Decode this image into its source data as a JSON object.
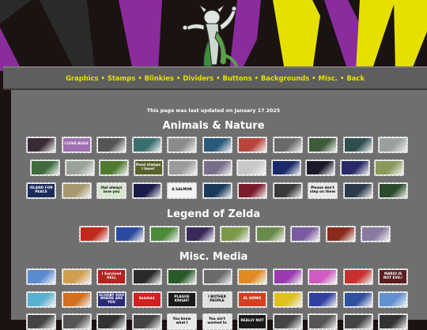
{
  "nav": {
    "links": [
      "Graphics",
      "Stamps",
      "Blinkies",
      "Dividers",
      "Buttons",
      "Backgrounds",
      "Misc.",
      "Back"
    ],
    "separator": "•"
  },
  "updated_text": "This page was last updated on January 17 2025",
  "sections": {
    "animals": {
      "title": "Animals & Nature"
    },
    "zelda": {
      "title": "Legend of Zelda"
    },
    "misc": {
      "title": "Misc. Media"
    }
  },
  "stamp_labels": {
    "i_love_bugs": "I LOVE BUGS",
    "pond_stamp": "Pond stamps I have!",
    "island_lover": "ISLAND FOR PEACE",
    "owl": "Owl always love you",
    "salmon": "A SALMON",
    "please_dont": "Please don't step on them",
    "survived_hell": "I Survived HELL",
    "seinfeld": "Seinfeld",
    "scooby": "SCOOBY DOO WHERE ARE YOU",
    "plague_knight": "PLAGUE KNIGHT",
    "bother_people": "I BOTHER PEOPLE",
    "el_homo": "EL HOMO",
    "mario_not_evil": "MARIO IS NOT EVIL!",
    "you_know_what": "You know what I",
    "you_aint_wanted": "You ain't wanted to",
    "really_not": "REALLY NOT"
  },
  "colors": {
    "nav_link": "#e6e000",
    "page_bg": "#1b1212",
    "panel_bg": "#6f6f6f"
  }
}
